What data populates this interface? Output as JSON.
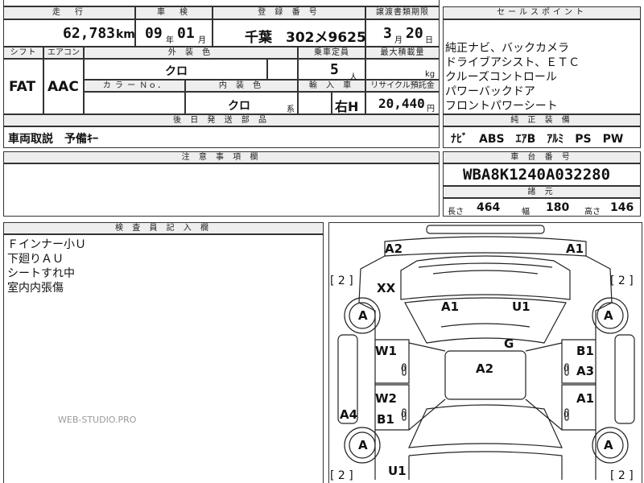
{
  "header": {
    "mileage_label": "走　行",
    "mileage": "62,783",
    "mileage_unit": "km",
    "inspection_label": "車　検",
    "inspection_year": "09",
    "inspection_year_unit": "年",
    "inspection_month": "01",
    "inspection_month_unit": "月",
    "registration_label": "登 録 番 号",
    "registration": "千葉　302メ9625",
    "transfer_label": "譲渡書類期限",
    "transfer_month": "3",
    "transfer_month_unit": "月",
    "transfer_day": "20",
    "transfer_day_unit": "日",
    "sales_points_label": "セールスポイント"
  },
  "row2": {
    "shift_label": "シフト",
    "shift": "FAT",
    "aircon_label": "エアコン",
    "aircon": "AAC",
    "exterior_label": "外 装 色",
    "exterior": "クロ",
    "capacity_label": "乗車定員",
    "capacity": "5",
    "capacity_unit": "人",
    "max_load_label": "最大積載量",
    "max_load_unit": "kg",
    "color_no_label": "カ ラ ー Ｎｏ．",
    "interior_label": "内 装 色",
    "interior": "クロ",
    "interior_suffix": "系",
    "import_label": "輸 入 車",
    "import": "右H",
    "recycle_label": "リサイクル預託金",
    "recycle": "20,440",
    "recycle_unit": "円"
  },
  "sales_points": [
    "純正ナビ、バックカメラ",
    "ドライブアシスト、ＥＴＣ",
    "クルーズコントロール",
    "パワーバックドア",
    "フロントパワーシート"
  ],
  "later_parts": {
    "label": "後 日 発 送 部 品",
    "value": "車両取説　予備ｷｰ"
  },
  "factory_equipment": {
    "label": "純 正 装 備",
    "value": "ﾅﾋﾞ　ABS　ｴｱB　ｱﾙﾐ　PS　PW"
  },
  "notes": {
    "label": "注 意 事 項 欄"
  },
  "chassis": {
    "label": "車 台 番 号",
    "value": "WBA8K1240A032280"
  },
  "dimensions": {
    "label": "諸 元",
    "length_label": "長さ",
    "length": "464",
    "width_label": "幅",
    "width": "180",
    "height_label": "高さ",
    "height": "146"
  },
  "inspector": {
    "label": "検 査 員 記 入 欄",
    "lines": [
      "Ｆインナー小Ｕ",
      "下廻りＡＵ",
      "シートすれ中",
      "室内内張傷"
    ]
  },
  "watermark": "WEB-STUDIO.PRO",
  "diagram": {
    "bracket_tl": "[ 2 ]",
    "bracket_tr": "[ 2 ]",
    "bracket_bl": "[ 2 ]",
    "bracket_br": "[ 2 ]",
    "front_left": "A2",
    "front_right": "A1",
    "fender_left": "XX",
    "hood_left": "A1",
    "hood_right": "U1",
    "windshield": "G",
    "roof": "A2",
    "door_fl": "W1",
    "door_fr": "B1",
    "door_fr2": "A3",
    "door_rl": "W2",
    "door_rl2": "B1",
    "door_rr": "A1",
    "sill_left": "A4",
    "rear_left": "U1",
    "wheel_fl": "A",
    "wheel_fr": "A",
    "wheel_rl": "A",
    "wheel_rr": "A",
    "marker": "0"
  }
}
